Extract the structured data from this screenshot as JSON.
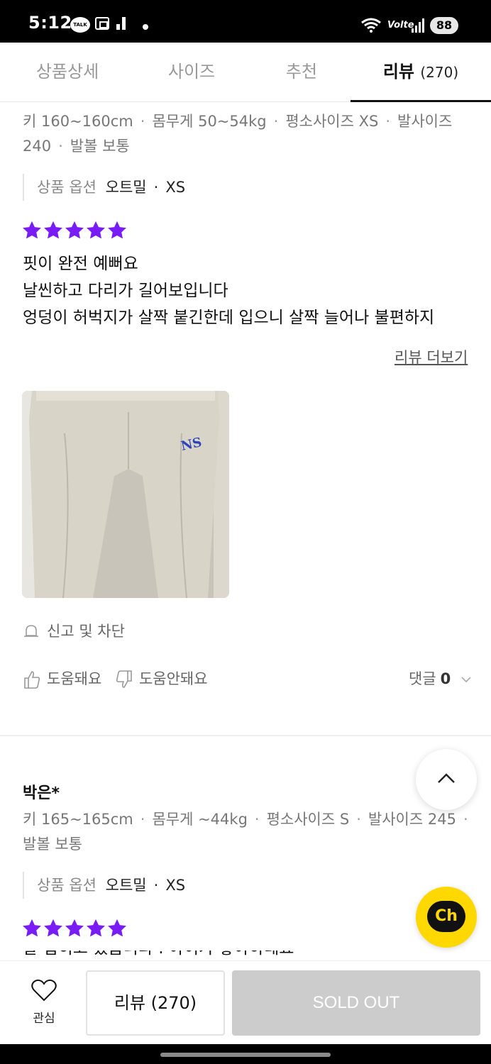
{
  "status_bar": {
    "time": "5:12",
    "talk_label": "TALK",
    "network_label": "Volte",
    "battery": "88"
  },
  "tabs": [
    {
      "label": "상품상세"
    },
    {
      "label": "사이즈"
    },
    {
      "label": "추천"
    },
    {
      "label": "리뷰",
      "count": "(270)"
    }
  ],
  "review1": {
    "meta": [
      "키 160~160cm",
      "몸무게 50~54kg",
      "평소사이즈 XS",
      "발사이즈 240",
      "발볼 보통"
    ],
    "option_label": "상품 옵션",
    "option_color": "오트밀",
    "option_size": "XS",
    "rating": 5,
    "text_lines": [
      "핏이 완전 예뻐요",
      "날씬하고 다리가 길어보입니다",
      "엉덩이 허벅지가 살짝 붙긴한데 입으니 살짝 늘어나 불편하지"
    ],
    "more_label": "리뷰 더보기",
    "report_label": "신고 및 차단",
    "helpful_label": "도움돼요",
    "not_helpful_label": "도움안돼요",
    "comments_label": "댓글",
    "comments_count": "0"
  },
  "review2": {
    "reviewer": "박은*",
    "meta": [
      "키 165~165cm",
      "몸무게 ~44kg",
      "평소사이즈 S",
      "발사이즈 245",
      "발볼 보통"
    ],
    "option_label": "상품 옵션",
    "option_color": "오트밀",
    "option_size": "XS",
    "rating": 5,
    "text_partial": "잘 입히고 있습니다 . 아이가 좋아하네요"
  },
  "bottom_bar": {
    "like_label": "관심",
    "review_button_label": "리뷰 (270)",
    "soldout_label": "SOLD OUT"
  },
  "floating": {
    "channel_label": "Ch"
  },
  "colors": {
    "star": "#7a1cf5",
    "soldout_bg": "#cccccc",
    "channel_bg": "#ffd800"
  }
}
